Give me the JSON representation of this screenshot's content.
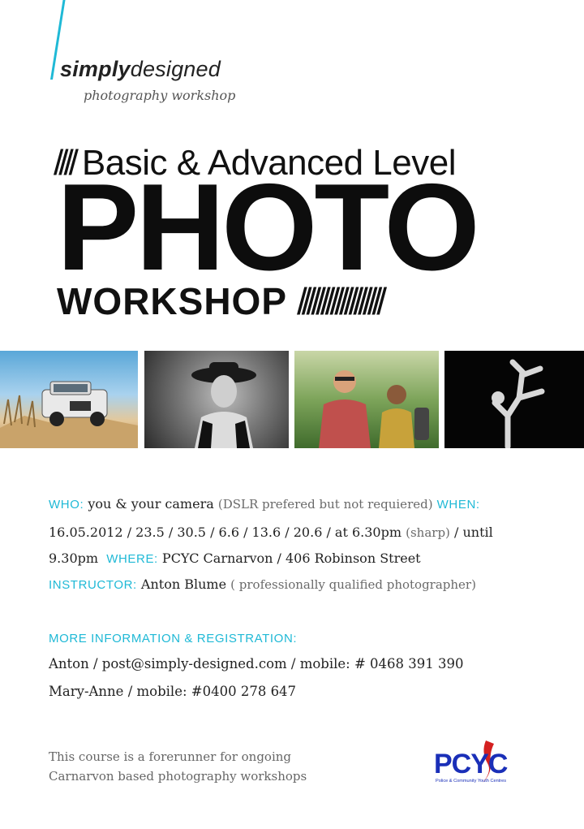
{
  "brand": {
    "name_bold": "simply",
    "name_rest": "designed",
    "tagline": "photography workshop"
  },
  "headline": {
    "prefix_slashes": "////",
    "level": "Basic & Advanced Level",
    "main_word": "PHOTO",
    "sub_word": "WORKSHOP",
    "trailing_slashes": "//////////////////"
  },
  "photos": [
    {
      "icon": "off-road-vehicle-photo"
    },
    {
      "icon": "woman-in-hat-portrait-photo"
    },
    {
      "icon": "hikers-with-backpacks-photo"
    },
    {
      "icon": "breakdancer-photo"
    }
  ],
  "details": {
    "who_label": "WHO:",
    "who_value": "you & your camera",
    "who_note": "(DSLR prefered but not requiered)",
    "when_label": "WHEN:",
    "when_value": "16.05.2012 / 23.5 / 30.5 / 6.6 / 13.6 / 20.6 / at 6.30pm",
    "when_note": "(sharp)",
    "when_until": "/ until",
    "end_time": "9.30pm",
    "where_label": "WHERE:",
    "where_value": "PCYC Carnarvon / 406 Robinson Street",
    "instructor_label": "INSTRUCTOR:",
    "instructor_value": "Anton Blume",
    "instructor_note": "( professionally qualified photographer)"
  },
  "registration": {
    "label": "MORE INFORMATION & REGISTRATION:",
    "contact_1": "Anton / post@simply-designed.com / mobile: # 0468 391 390",
    "contact_2": "Mary-Anne / mobile: #0400 278 647"
  },
  "footer": {
    "line_1": "This course is a forerunner for ongoing",
    "line_2": "Carnarvon based photography workshops"
  },
  "logo": {
    "text": "PCYC",
    "subtitle": "Police & Community Youth Centres"
  },
  "colors": {
    "accent": "#1fb9d6",
    "logo_blue": "#1a2fb8",
    "logo_red": "#d42020"
  }
}
